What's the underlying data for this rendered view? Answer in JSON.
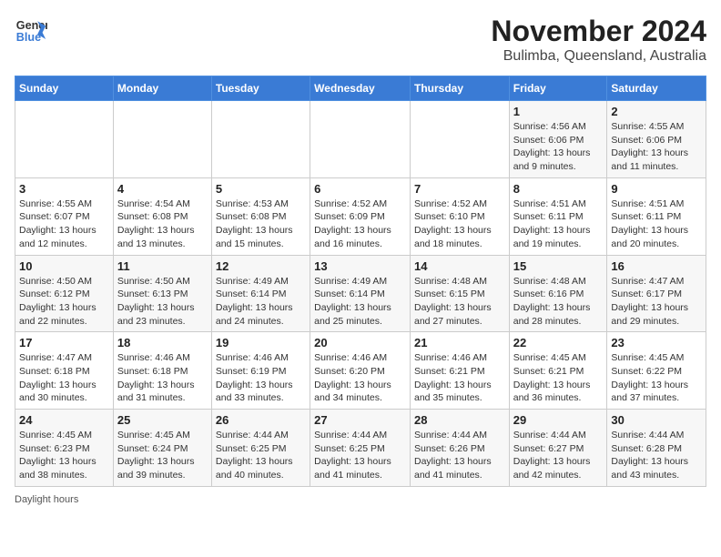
{
  "header": {
    "logo_line1": "General",
    "logo_line2": "Blue",
    "title": "November 2024",
    "subtitle": "Bulimba, Queensland, Australia"
  },
  "days_of_week": [
    "Sunday",
    "Monday",
    "Tuesday",
    "Wednesday",
    "Thursday",
    "Friday",
    "Saturday"
  ],
  "weeks": [
    [
      {
        "day": "",
        "info": ""
      },
      {
        "day": "",
        "info": ""
      },
      {
        "day": "",
        "info": ""
      },
      {
        "day": "",
        "info": ""
      },
      {
        "day": "",
        "info": ""
      },
      {
        "day": "1",
        "info": "Sunrise: 4:56 AM\nSunset: 6:06 PM\nDaylight: 13 hours and 9 minutes."
      },
      {
        "day": "2",
        "info": "Sunrise: 4:55 AM\nSunset: 6:06 PM\nDaylight: 13 hours and 11 minutes."
      }
    ],
    [
      {
        "day": "3",
        "info": "Sunrise: 4:55 AM\nSunset: 6:07 PM\nDaylight: 13 hours and 12 minutes."
      },
      {
        "day": "4",
        "info": "Sunrise: 4:54 AM\nSunset: 6:08 PM\nDaylight: 13 hours and 13 minutes."
      },
      {
        "day": "5",
        "info": "Sunrise: 4:53 AM\nSunset: 6:08 PM\nDaylight: 13 hours and 15 minutes."
      },
      {
        "day": "6",
        "info": "Sunrise: 4:52 AM\nSunset: 6:09 PM\nDaylight: 13 hours and 16 minutes."
      },
      {
        "day": "7",
        "info": "Sunrise: 4:52 AM\nSunset: 6:10 PM\nDaylight: 13 hours and 18 minutes."
      },
      {
        "day": "8",
        "info": "Sunrise: 4:51 AM\nSunset: 6:11 PM\nDaylight: 13 hours and 19 minutes."
      },
      {
        "day": "9",
        "info": "Sunrise: 4:51 AM\nSunset: 6:11 PM\nDaylight: 13 hours and 20 minutes."
      }
    ],
    [
      {
        "day": "10",
        "info": "Sunrise: 4:50 AM\nSunset: 6:12 PM\nDaylight: 13 hours and 22 minutes."
      },
      {
        "day": "11",
        "info": "Sunrise: 4:50 AM\nSunset: 6:13 PM\nDaylight: 13 hours and 23 minutes."
      },
      {
        "day": "12",
        "info": "Sunrise: 4:49 AM\nSunset: 6:14 PM\nDaylight: 13 hours and 24 minutes."
      },
      {
        "day": "13",
        "info": "Sunrise: 4:49 AM\nSunset: 6:14 PM\nDaylight: 13 hours and 25 minutes."
      },
      {
        "day": "14",
        "info": "Sunrise: 4:48 AM\nSunset: 6:15 PM\nDaylight: 13 hours and 27 minutes."
      },
      {
        "day": "15",
        "info": "Sunrise: 4:48 AM\nSunset: 6:16 PM\nDaylight: 13 hours and 28 minutes."
      },
      {
        "day": "16",
        "info": "Sunrise: 4:47 AM\nSunset: 6:17 PM\nDaylight: 13 hours and 29 minutes."
      }
    ],
    [
      {
        "day": "17",
        "info": "Sunrise: 4:47 AM\nSunset: 6:18 PM\nDaylight: 13 hours and 30 minutes."
      },
      {
        "day": "18",
        "info": "Sunrise: 4:46 AM\nSunset: 6:18 PM\nDaylight: 13 hours and 31 minutes."
      },
      {
        "day": "19",
        "info": "Sunrise: 4:46 AM\nSunset: 6:19 PM\nDaylight: 13 hours and 33 minutes."
      },
      {
        "day": "20",
        "info": "Sunrise: 4:46 AM\nSunset: 6:20 PM\nDaylight: 13 hours and 34 minutes."
      },
      {
        "day": "21",
        "info": "Sunrise: 4:46 AM\nSunset: 6:21 PM\nDaylight: 13 hours and 35 minutes."
      },
      {
        "day": "22",
        "info": "Sunrise: 4:45 AM\nSunset: 6:21 PM\nDaylight: 13 hours and 36 minutes."
      },
      {
        "day": "23",
        "info": "Sunrise: 4:45 AM\nSunset: 6:22 PM\nDaylight: 13 hours and 37 minutes."
      }
    ],
    [
      {
        "day": "24",
        "info": "Sunrise: 4:45 AM\nSunset: 6:23 PM\nDaylight: 13 hours and 38 minutes."
      },
      {
        "day": "25",
        "info": "Sunrise: 4:45 AM\nSunset: 6:24 PM\nDaylight: 13 hours and 39 minutes."
      },
      {
        "day": "26",
        "info": "Sunrise: 4:44 AM\nSunset: 6:25 PM\nDaylight: 13 hours and 40 minutes."
      },
      {
        "day": "27",
        "info": "Sunrise: 4:44 AM\nSunset: 6:25 PM\nDaylight: 13 hours and 41 minutes."
      },
      {
        "day": "28",
        "info": "Sunrise: 4:44 AM\nSunset: 6:26 PM\nDaylight: 13 hours and 41 minutes."
      },
      {
        "day": "29",
        "info": "Sunrise: 4:44 AM\nSunset: 6:27 PM\nDaylight: 13 hours and 42 minutes."
      },
      {
        "day": "30",
        "info": "Sunrise: 4:44 AM\nSunset: 6:28 PM\nDaylight: 13 hours and 43 minutes."
      }
    ]
  ],
  "footer": {
    "daylight_label": "Daylight hours"
  }
}
